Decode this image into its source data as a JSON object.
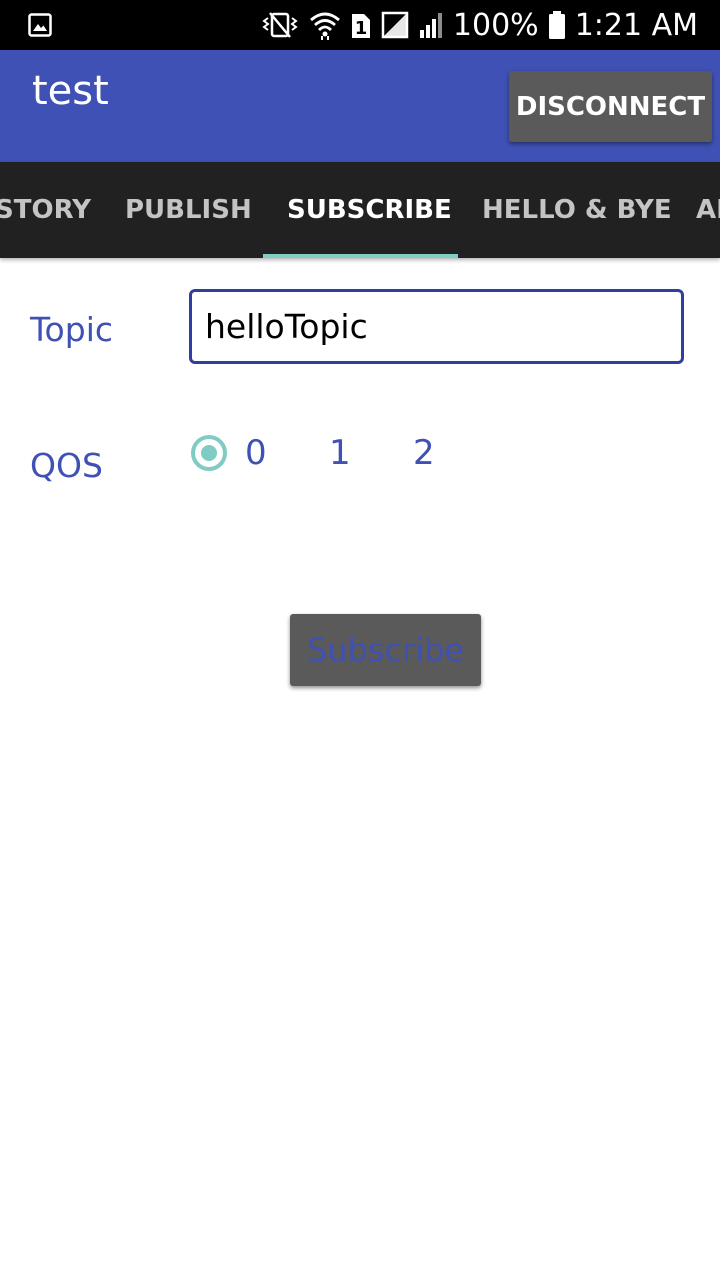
{
  "status_bar": {
    "left_icon": "gallery-icon",
    "icons": [
      "vibrate-icon",
      "wifi-icon",
      "sim1-icon",
      "no-sim-icon",
      "cell-signal-icon",
      "battery-icon"
    ],
    "sim_label": "1",
    "battery": "100%",
    "time": "1:21 AM"
  },
  "app_bar": {
    "title": "test",
    "disconnect_label": "DISCONNECT",
    "color": "#3f51b5"
  },
  "tabs": [
    {
      "label": "STORY",
      "active": false
    },
    {
      "label": "PUBLISH",
      "active": false
    },
    {
      "label": "SUBSCRIBE",
      "active": true
    },
    {
      "label": "HELLO & BYE",
      "active": false
    },
    {
      "label": "AB",
      "active": false
    }
  ],
  "form": {
    "topic_label": "Topic",
    "topic_value": "helloTopic",
    "qos_label": "QOS",
    "qos_options": [
      "0",
      "1",
      "2"
    ],
    "qos_selected": "0",
    "subscribe_label": "Subscribe"
  },
  "colors": {
    "accent": "#80cbc4",
    "primary": "#3f51b5",
    "tab_bar": "#212121",
    "button": "#5a5a5a"
  }
}
